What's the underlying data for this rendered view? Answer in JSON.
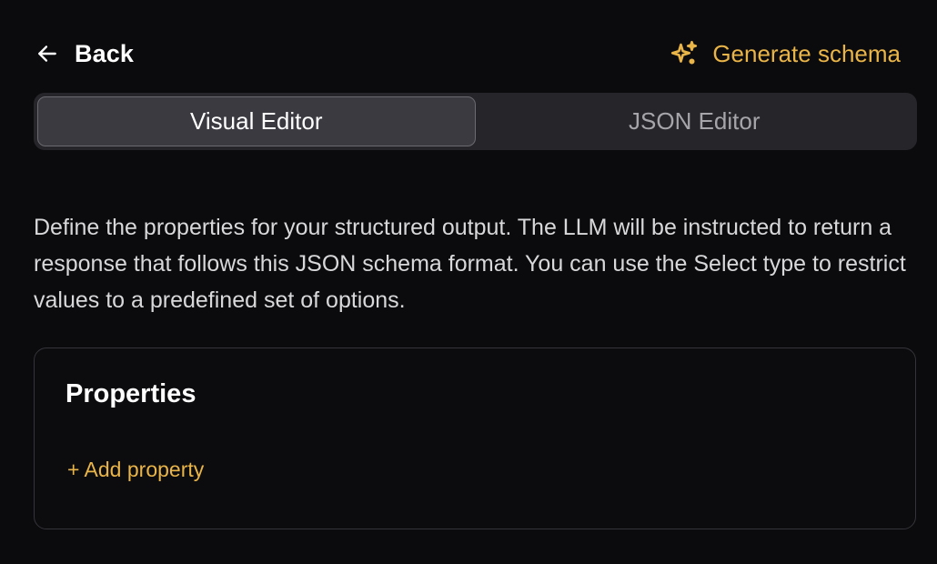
{
  "header": {
    "back_label": "Back",
    "back_icon": "arrow-left-icon",
    "generate_label": "Generate schema",
    "generate_icon": "sparkles-icon"
  },
  "tabs": [
    {
      "label": "Visual Editor",
      "active": true
    },
    {
      "label": "JSON Editor",
      "active": false
    }
  ],
  "description": "Define the properties for your structured output. The LLM will be instructed to return a response that follows this JSON schema format. You can use the Select type to restrict values to a predefined set of options.",
  "properties": {
    "title": "Properties",
    "add_label": "+ Add property"
  },
  "colors": {
    "background": "#0b0b0d",
    "accent": "#e9b448",
    "tab_track": "#26262a",
    "tab_active": "#3a3a40"
  }
}
